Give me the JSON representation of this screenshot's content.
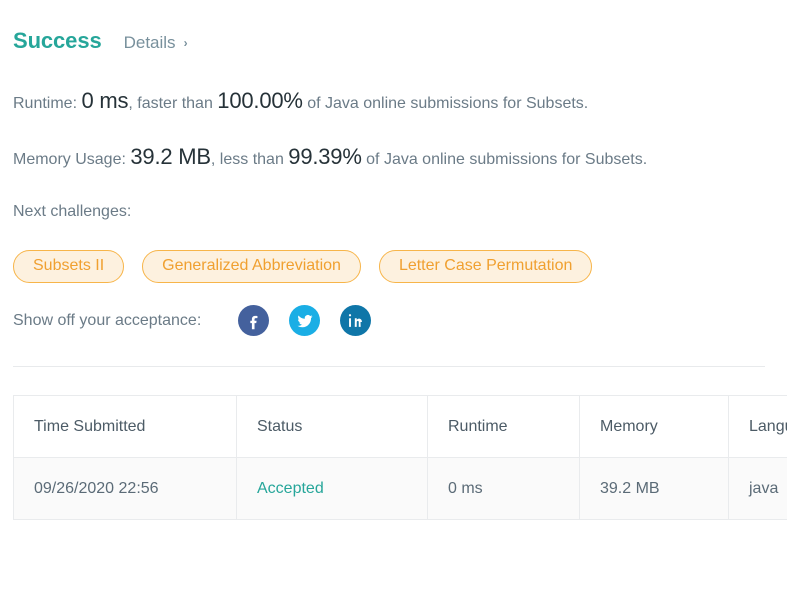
{
  "header": {
    "status_title": "Success",
    "details_label": "Details",
    "chevron_glyph": "›"
  },
  "stats": {
    "runtime": {
      "label": "Runtime:",
      "value": "0 ms",
      "comparator": ", faster than ",
      "percent": "100.00%",
      "suffix": " of Java online submissions for Subsets."
    },
    "memory": {
      "label": "Memory Usage:",
      "value": "39.2 MB",
      "comparator": ", less than ",
      "percent": "99.39%",
      "suffix": " of Java online submissions for Subsets."
    }
  },
  "next_challenges": {
    "label": "Next challenges:",
    "items": [
      {
        "label": "Subsets II"
      },
      {
        "label": "Generalized Abbreviation"
      },
      {
        "label": "Letter Case Permutation"
      }
    ]
  },
  "share": {
    "label": "Show off your acceptance:",
    "icons": [
      {
        "name": "facebook-icon",
        "color": "#44619d"
      },
      {
        "name": "twitter-icon",
        "color": "#1aaee5"
      },
      {
        "name": "linkedin-icon",
        "color": "#0f76a8"
      }
    ]
  },
  "submissions_table": {
    "columns": [
      "Time Submitted",
      "Status",
      "Runtime",
      "Memory",
      "Language"
    ],
    "rows": [
      {
        "time_submitted": "09/26/2020 22:56",
        "status": "Accepted",
        "runtime": "0 ms",
        "memory": "39.2 MB",
        "language": "java"
      }
    ]
  },
  "colors": {
    "success_teal": "#26a69a",
    "accepted_teal": "#26a69a",
    "pill_border": "#f7b54a",
    "pill_bg": "#fdf1df",
    "pill_text": "#f0a030",
    "body_gray": "#6b7b87",
    "value_dark": "#263238"
  }
}
